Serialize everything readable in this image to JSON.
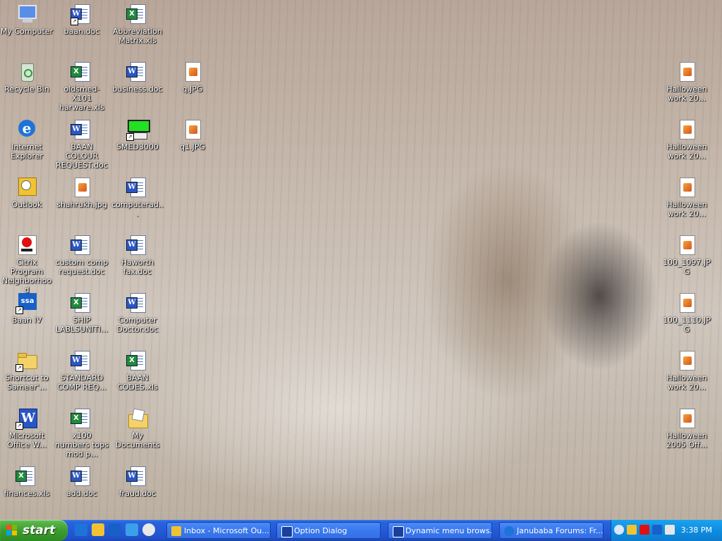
{
  "desktop": {
    "icons": [
      {
        "label": "My Computer",
        "type": "computer"
      },
      {
        "label": "Recycle Bin",
        "type": "recycle"
      },
      {
        "label": "Internet Explorer",
        "type": "ie"
      },
      {
        "label": "Outlook",
        "type": "outlook"
      },
      {
        "label": "Citrix Program Neighborhood",
        "type": "citrix"
      },
      {
        "label": "Baan IV",
        "type": "ssa",
        "shortcut": true
      },
      {
        "label": "Shortcut to Sameer'...",
        "type": "folder",
        "shortcut": true
      },
      {
        "label": "Microsoft Office W...",
        "type": "word-app",
        "shortcut": true
      },
      {
        "label": "finances.xls",
        "type": "xls"
      },
      {
        "label": "baan.doc",
        "type": "doc",
        "shortcut": true
      },
      {
        "label": "oldsmed-X101 harware.xls",
        "type": "xls"
      },
      {
        "label": "BAAN COLOUR REQUEST.doc",
        "type": "doc"
      },
      {
        "label": "shahrukh.jpg",
        "type": "jpg"
      },
      {
        "label": "custom comp request.doc",
        "type": "doc"
      },
      {
        "label": "SHIP LABLSUNITI...",
        "type": "xls"
      },
      {
        "label": "STANDARD COMP REQ...",
        "type": "doc"
      },
      {
        "label": "x100 numbers tops mod p...",
        "type": "xls"
      },
      {
        "label": "add.doc",
        "type": "doc"
      },
      {
        "label": "Abbreviation Matrix.xls",
        "type": "xls"
      },
      {
        "label": "business.doc",
        "type": "doc"
      },
      {
        "label": "SMED3000",
        "type": "smed",
        "shortcut": true
      },
      {
        "label": "computerad...",
        "type": "doc"
      },
      {
        "label": "Haworth fax.doc",
        "type": "doc"
      },
      {
        "label": "Computer Doctor.doc",
        "type": "doc"
      },
      {
        "label": "BAAN CODES.xls",
        "type": "xls"
      },
      {
        "label": "My Documents",
        "type": "mydocs"
      },
      {
        "label": "fraud.doc",
        "type": "doc"
      },
      {
        "label": "q.JPG",
        "type": "jpg"
      },
      {
        "label": "q1.JPG",
        "type": "jpg"
      },
      {
        "label": "Halloween work 20...",
        "type": "jpg"
      },
      {
        "label": "Halloween work 20...",
        "type": "jpg"
      },
      {
        "label": "Halloween work 20...",
        "type": "jpg"
      },
      {
        "label": "100_1097.JPG",
        "type": "jpg"
      },
      {
        "label": "100_1110.JPG",
        "type": "jpg"
      },
      {
        "label": "Halloween work 20...",
        "type": "jpg"
      },
      {
        "label": "Halloween 2005 Off...",
        "type": "jpg"
      }
    ]
  },
  "taskbar": {
    "start_label": "start",
    "quick_launch": [
      "ie-icon",
      "outlook-icon",
      "ssa-icon",
      "ie-alt-icon",
      "media-player-icon"
    ],
    "buttons": [
      {
        "label": "Inbox - Microsoft Ou...",
        "icon": "outlook-icon"
      },
      {
        "label": "Option Dialog",
        "icon": "baan-icon"
      },
      {
        "label": "Dynamic menu brows...",
        "icon": "baan-icon"
      },
      {
        "label": "Janubaba Forums: Fr...",
        "icon": "ie-icon"
      }
    ],
    "clock": "3:38 PM"
  }
}
